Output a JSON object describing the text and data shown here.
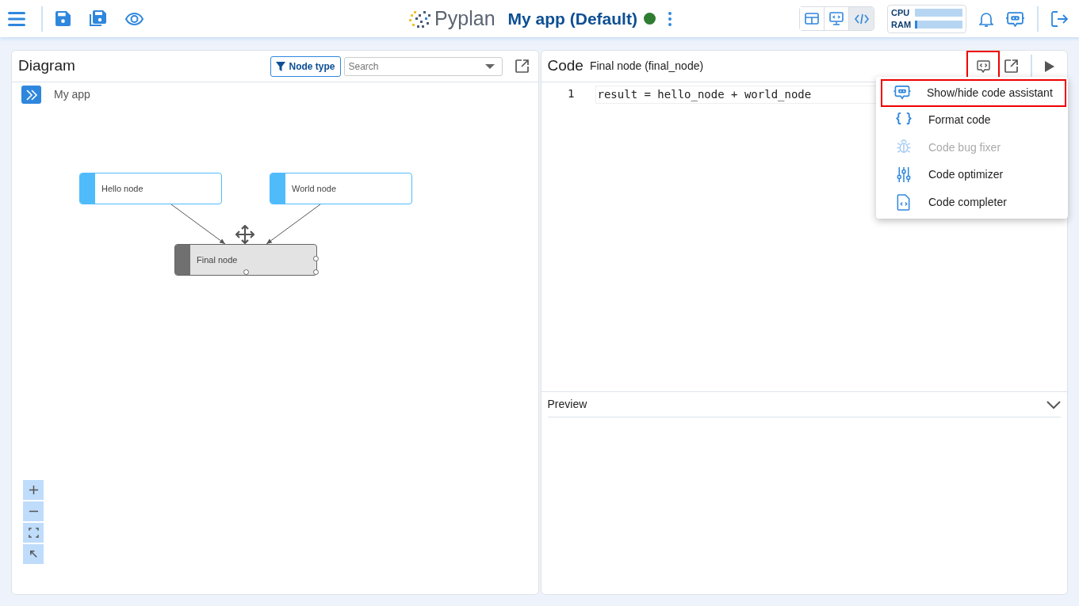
{
  "header": {
    "logo_text": "Pyplan",
    "app_title": "My app (Default)",
    "views": [
      {
        "selected": false
      },
      {
        "selected": false
      },
      {
        "selected": true
      }
    ],
    "meters": [
      {
        "label": "CPU",
        "level": 0.0
      },
      {
        "label": "RAM",
        "level": 0.03
      }
    ]
  },
  "diagram": {
    "title": "Diagram",
    "filter_button": "Node type",
    "search": {
      "placeholder": "Search"
    },
    "breadcrumb": "My app",
    "nodes": [
      {
        "label": "Hello node",
        "selected": false
      },
      {
        "label": "World node",
        "selected": false
      },
      {
        "label": "Final node",
        "selected": true
      }
    ]
  },
  "code": {
    "title": "Code",
    "subtitle": "Final node (final_node)",
    "assistant_highlighted": true,
    "lines": [
      {
        "number": "1",
        "text": "result = hello_node + world_node"
      }
    ],
    "menu": [
      {
        "label": "Show/hide code assistant",
        "disabled": false,
        "highlighted": true
      },
      {
        "label": "Format code",
        "disabled": false,
        "highlighted": false
      },
      {
        "label": "Code bug fixer",
        "disabled": true,
        "highlighted": false
      },
      {
        "label": "Code optimizer",
        "disabled": false,
        "highlighted": false
      },
      {
        "label": "Code completer",
        "disabled": false,
        "highlighted": false
      }
    ],
    "preview": {
      "title": "Preview"
    }
  }
}
